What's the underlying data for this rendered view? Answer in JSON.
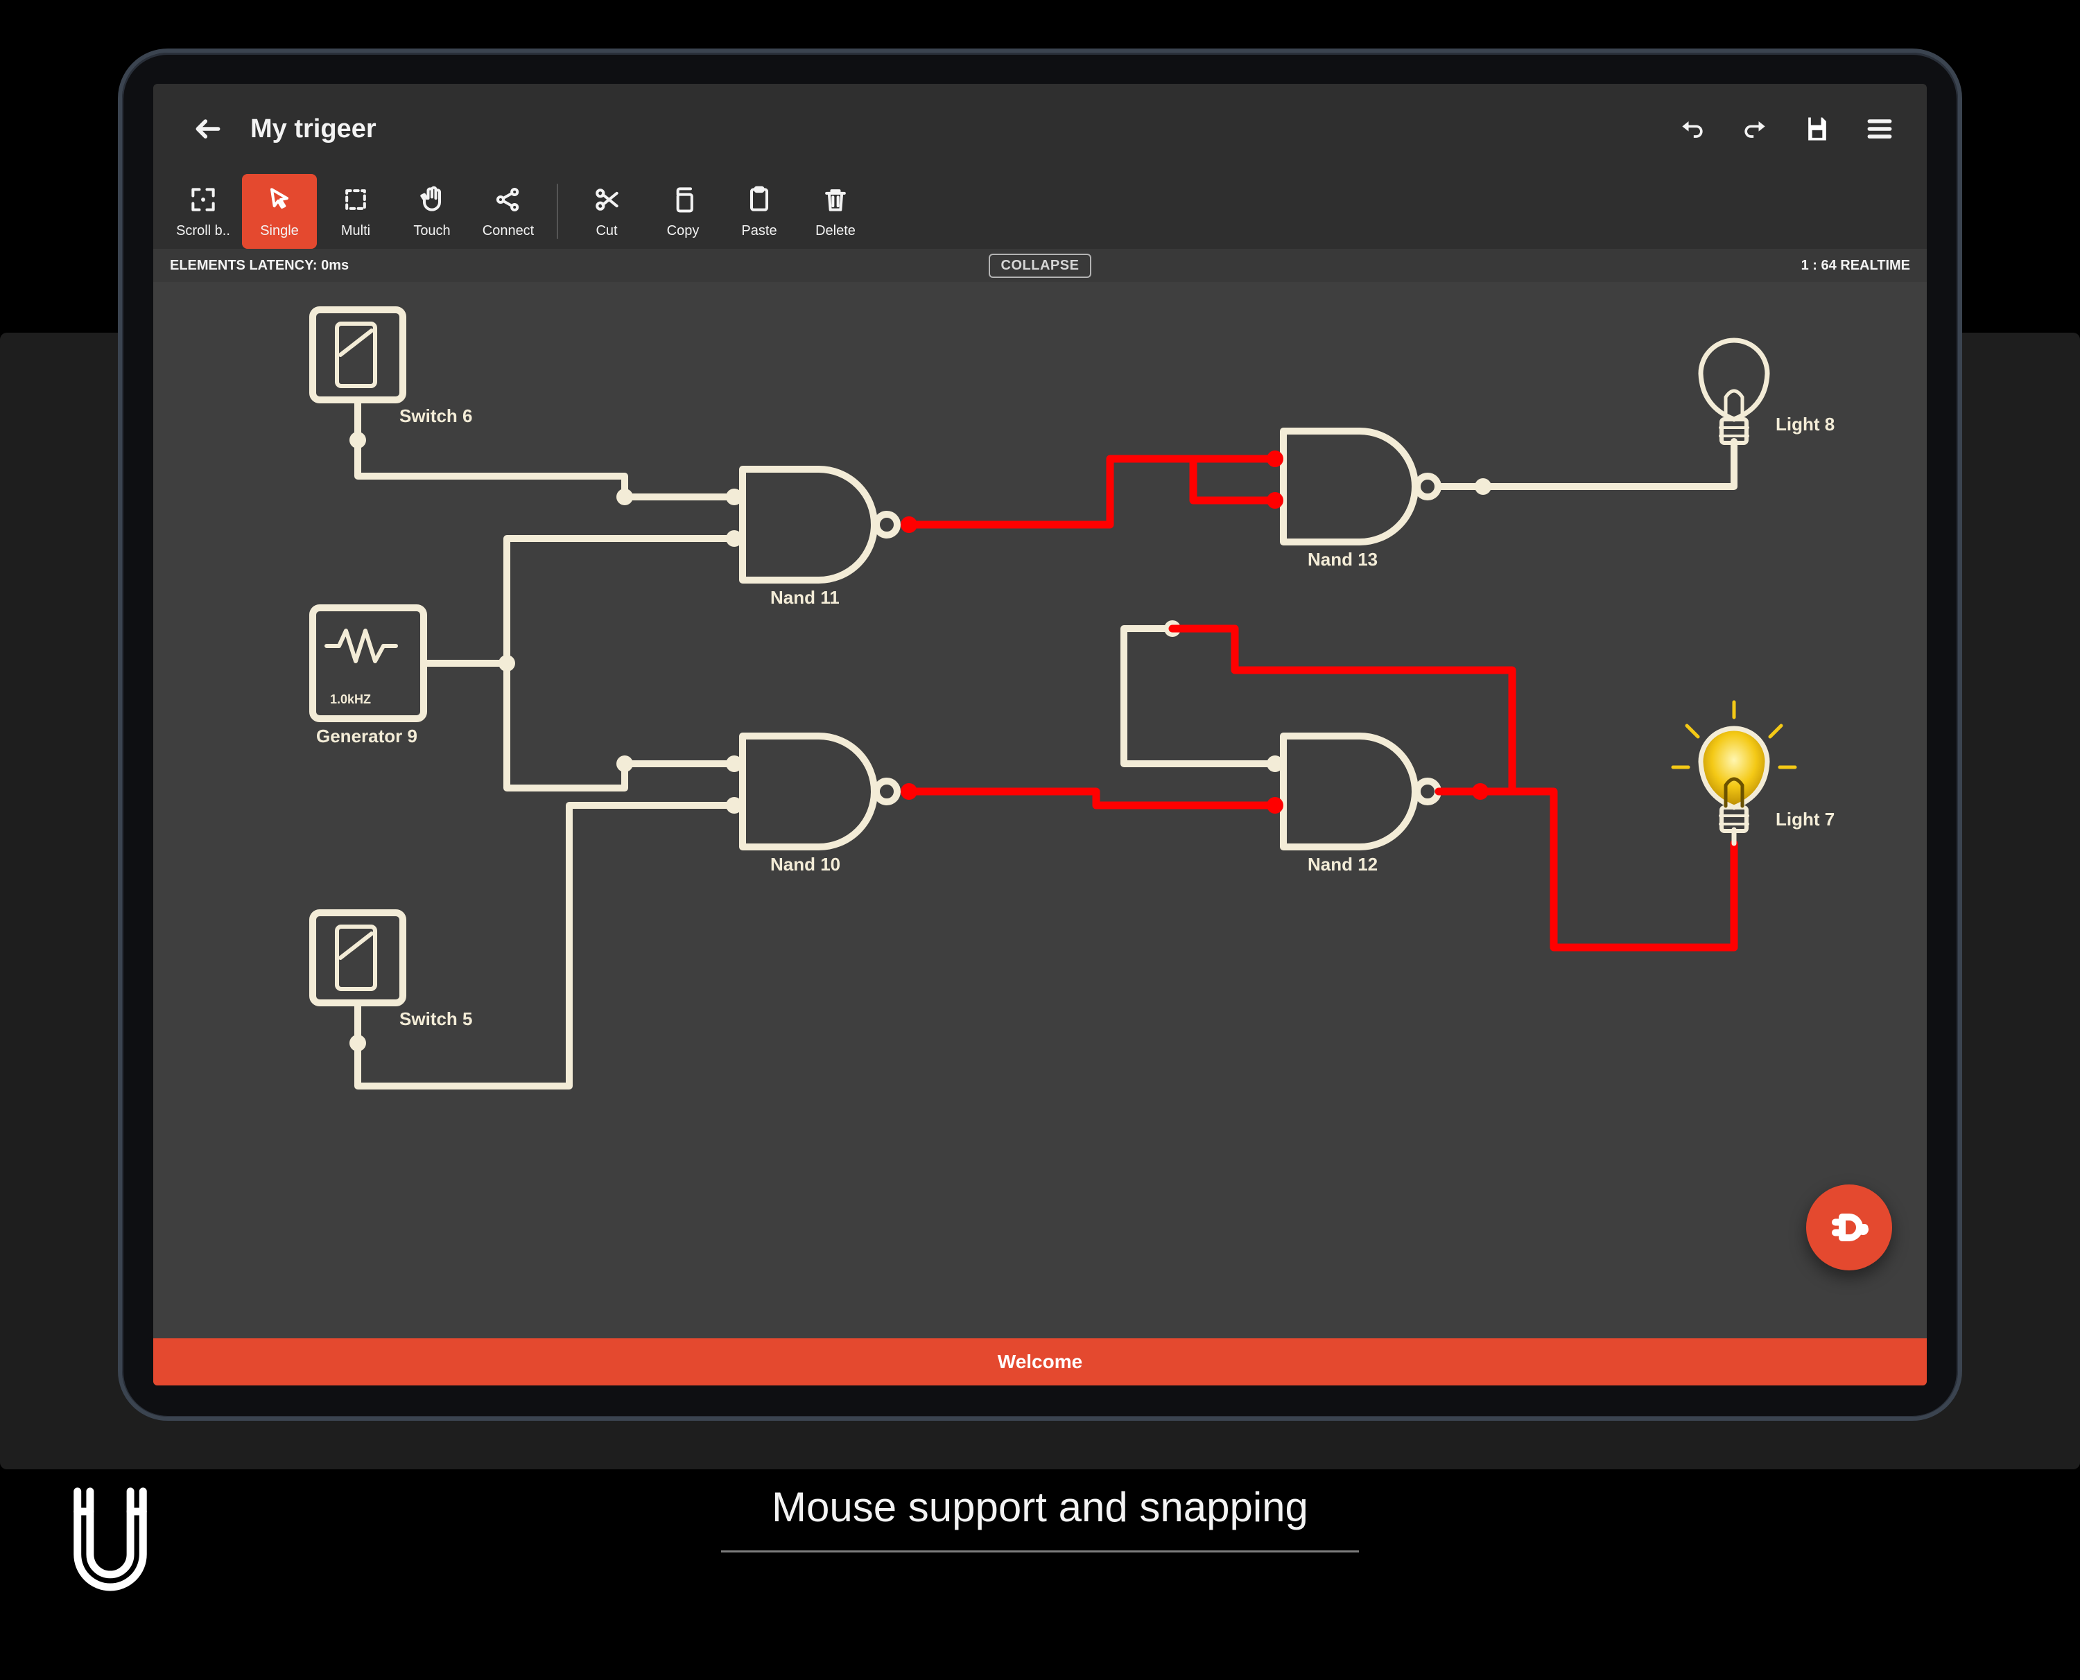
{
  "header": {
    "title": "My trigeer"
  },
  "toolbar": {
    "scroll": "Scroll b..",
    "single": "Single",
    "multi": "Multi",
    "touch": "Touch",
    "connect": "Connect",
    "cut": "Cut",
    "copy": "Copy",
    "paste": "Paste",
    "delete": "Delete"
  },
  "status": {
    "latency": "ELEMENTS LATENCY: 0ms",
    "collapse_label": "COLLAPSE",
    "realtime": "1 : 64 REALTIME"
  },
  "nodes": {
    "switch6": "Switch 6",
    "switch5": "Switch 5",
    "generator9_label": "Generator 9",
    "generator9_freq": "1.0kHZ",
    "nand11": "Nand 11",
    "nand10": "Nand 10",
    "nand13": "Nand 13",
    "nand12": "Nand 12",
    "light8": "Light 8",
    "light7": "Light 7"
  },
  "colors": {
    "wire_off": "#f3ecd7",
    "wire_on": "#ff0000",
    "accent": "#e4492f",
    "bulb_on_fill": "#f4c916"
  },
  "bottom": {
    "welcome": "Welcome"
  },
  "caption": {
    "text": "Mouse support and snapping"
  }
}
